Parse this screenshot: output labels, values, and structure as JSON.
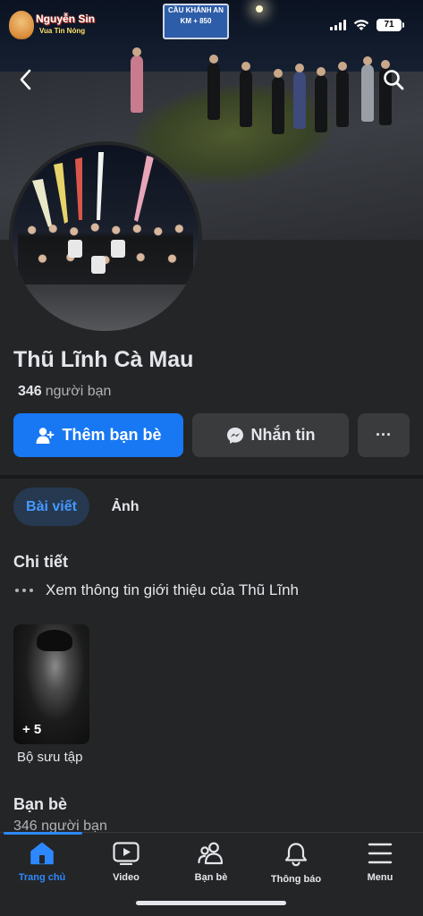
{
  "status_bar": {
    "battery": "71"
  },
  "watermark": {
    "line1": "Nguyễn Sin",
    "line2": "Vua Tin Nóng"
  },
  "cover": {
    "sign_line1": "CẦU KHÁNH AN",
    "sign_line2": "KM + 850"
  },
  "profile": {
    "name": "Thũ Lĩnh Cà Mau",
    "friends_count": "346",
    "friends_label": "người bạn"
  },
  "actions": {
    "add_friend": "Thêm bạn bè",
    "message": "Nhắn tin",
    "more": "···"
  },
  "tabs": [
    {
      "label": "Bài viết",
      "active": true
    },
    {
      "label": "Ảnh",
      "active": false
    }
  ],
  "details": {
    "title": "Chi tiết",
    "intro_link": "Xem thông tin giới thiệu của Thũ Lĩnh"
  },
  "collection": {
    "count": "+ 5",
    "label": "Bộ sưu tập"
  },
  "friends_section": {
    "title": "Bạn bè",
    "count_text": "346 người bạn"
  },
  "bottom_nav": [
    {
      "label": "Trang chủ",
      "icon": "home-icon",
      "active": true
    },
    {
      "label": "Video",
      "icon": "video-icon",
      "active": false
    },
    {
      "label": "Bạn bè",
      "icon": "friends-icon",
      "active": false
    },
    {
      "label": "Thông báo",
      "icon": "bell-icon",
      "active": false
    },
    {
      "label": "Menu",
      "icon": "menu-icon",
      "active": false
    }
  ],
  "colors": {
    "accent": "#1877f2",
    "background": "#242526",
    "active_tab_bg": "#263951",
    "active_text": "#2d88ff"
  }
}
